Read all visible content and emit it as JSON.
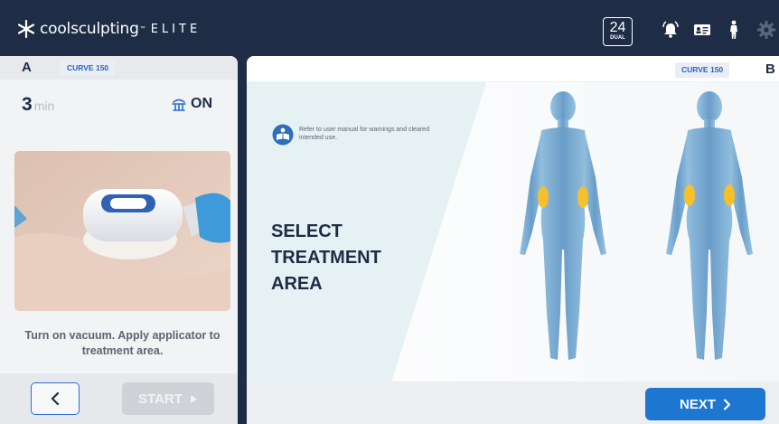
{
  "header": {
    "brand_name": "coolsculpting",
    "brand_tm": "™",
    "brand_tier": "ELITE",
    "counter_value": "24",
    "counter_label": "DUAL",
    "icons": [
      "alarm-bell-icon",
      "id-card-icon",
      "person-icon",
      "gear-icon"
    ]
  },
  "left_panel": {
    "side_letter": "A",
    "curve_label": "CURVE 150",
    "timer_value": "3",
    "timer_unit": "min",
    "vacuum_icon": "vacuum-icon",
    "vacuum_state": "ON",
    "instruction": "Turn on vacuum. Apply applicator to treatment area.",
    "back_icon": "chevron-left-icon",
    "start_label": "START"
  },
  "right_panel": {
    "side_letter": "B",
    "curve_label": "CURVE 150",
    "note": "Refer to user manual for warnings and cleared intended use.",
    "headline_lines": [
      "SELECT",
      "TREATMENT",
      "AREA"
    ],
    "next_label": "NEXT"
  },
  "colors": {
    "header_bg": "#1e2c46",
    "accent_blue": "#1d76cf",
    "treatment_zone": "#f5c02a",
    "body_blue": "#7fb2d8"
  }
}
